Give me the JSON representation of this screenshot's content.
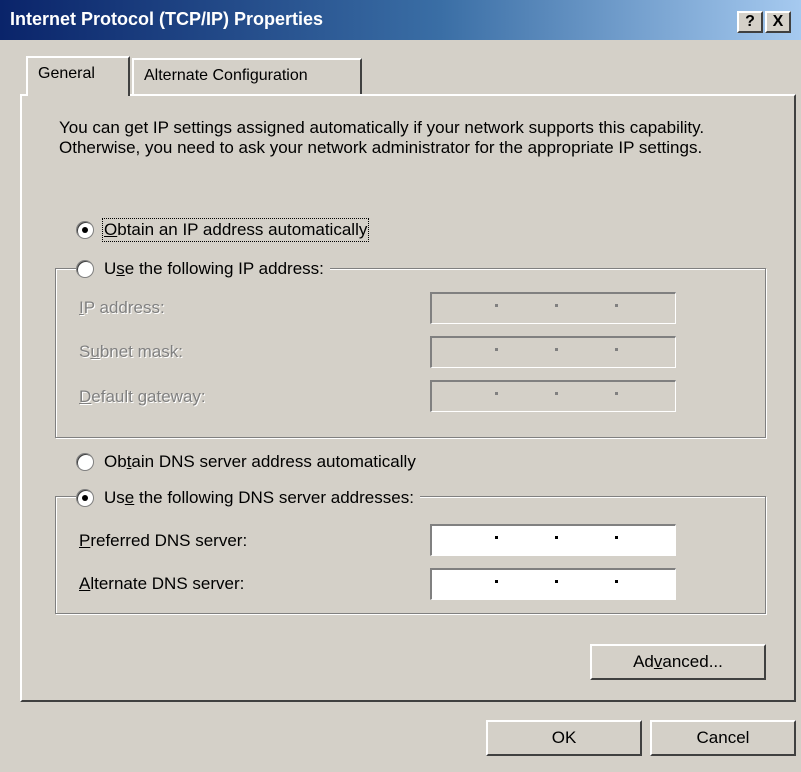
{
  "window": {
    "title": "Internet Protocol (TCP/IP) Properties",
    "help_button": "?",
    "close_button": "X"
  },
  "tabs": [
    {
      "label": "General",
      "selected": true
    },
    {
      "label": "Alternate Configuration",
      "selected": false
    }
  ],
  "intro_text": "You can get IP settings assigned automatically if your network supports this capability. Otherwise, you need to ask your network administrator for the appropriate IP settings.",
  "ip_section": {
    "radio_auto": {
      "label_pre": "",
      "label_mnemonic": "O",
      "label_post": "btain an IP address automatically",
      "checked": true
    },
    "radio_manual": {
      "label_pre": "U",
      "label_mnemonic": "s",
      "label_post": "e the following IP address:",
      "checked": false
    },
    "fields": [
      {
        "label_pre": "",
        "label_mnemonic": "I",
        "label_post": "P address:",
        "value": ". . .",
        "enabled": false
      },
      {
        "label_pre": "S",
        "label_mnemonic": "u",
        "label_post": "bnet mask:",
        "value": ". . .",
        "enabled": false
      },
      {
        "label_pre": "",
        "label_mnemonic": "D",
        "label_post": "efault gateway:",
        "value": ". . .",
        "enabled": false
      }
    ]
  },
  "dns_section": {
    "radio_auto": {
      "label_pre": "Ob",
      "label_mnemonic": "t",
      "label_post": "ain DNS server address automatically",
      "checked": false
    },
    "radio_manual": {
      "label_pre": "Us",
      "label_mnemonic": "e",
      "label_post": " the following DNS server addresses:",
      "checked": true
    },
    "fields": [
      {
        "label_pre": "",
        "label_mnemonic": "P",
        "label_post": "referred DNS server:",
        "value": ". . .",
        "enabled": true
      },
      {
        "label_pre": "",
        "label_mnemonic": "A",
        "label_post": "lternate DNS server:",
        "value": ". . .",
        "enabled": true
      }
    ]
  },
  "buttons": {
    "advanced": {
      "pre": "Ad",
      "mnemonic": "v",
      "post": "anced..."
    },
    "ok": "OK",
    "cancel": "Cancel"
  }
}
